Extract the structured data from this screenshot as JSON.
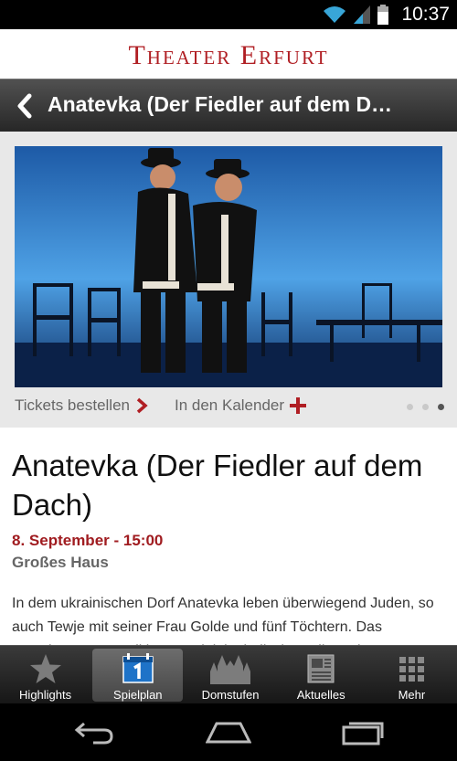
{
  "status": {
    "time": "10:37"
  },
  "header": {
    "logo_text": "Theater Erfurt"
  },
  "titlebar": {
    "title": "Anatevka (Der Fiedler auf dem D…"
  },
  "actions": {
    "tickets": "Tickets bestellen",
    "calendar": "In den Kalender"
  },
  "carousel": {
    "count": 3,
    "active_index": 2
  },
  "event": {
    "title": "Anatevka (Der Fiedler auf dem Dach)",
    "date": "8. September - 15:00",
    "venue": "Großes Haus",
    "description": "In dem ukrainischen Dorf Anatevka leben überwiegend Juden, so auch Tewje mit seiner Frau Golde und fünf Töchtern. Das Bewahren von Traditionen spielt im jüdischen Alltag eine"
  },
  "tabs": [
    {
      "label": "Highlights",
      "icon": "star-icon"
    },
    {
      "label": "Spielplan",
      "icon": "calendar-icon"
    },
    {
      "label": "Domstufen",
      "icon": "cathedral-icon"
    },
    {
      "label": "Aktuelles",
      "icon": "newspaper-icon"
    },
    {
      "label": "Mehr",
      "icon": "grid-icon"
    }
  ],
  "colors": {
    "accent": "#b01e23",
    "date": "#a01c20"
  }
}
